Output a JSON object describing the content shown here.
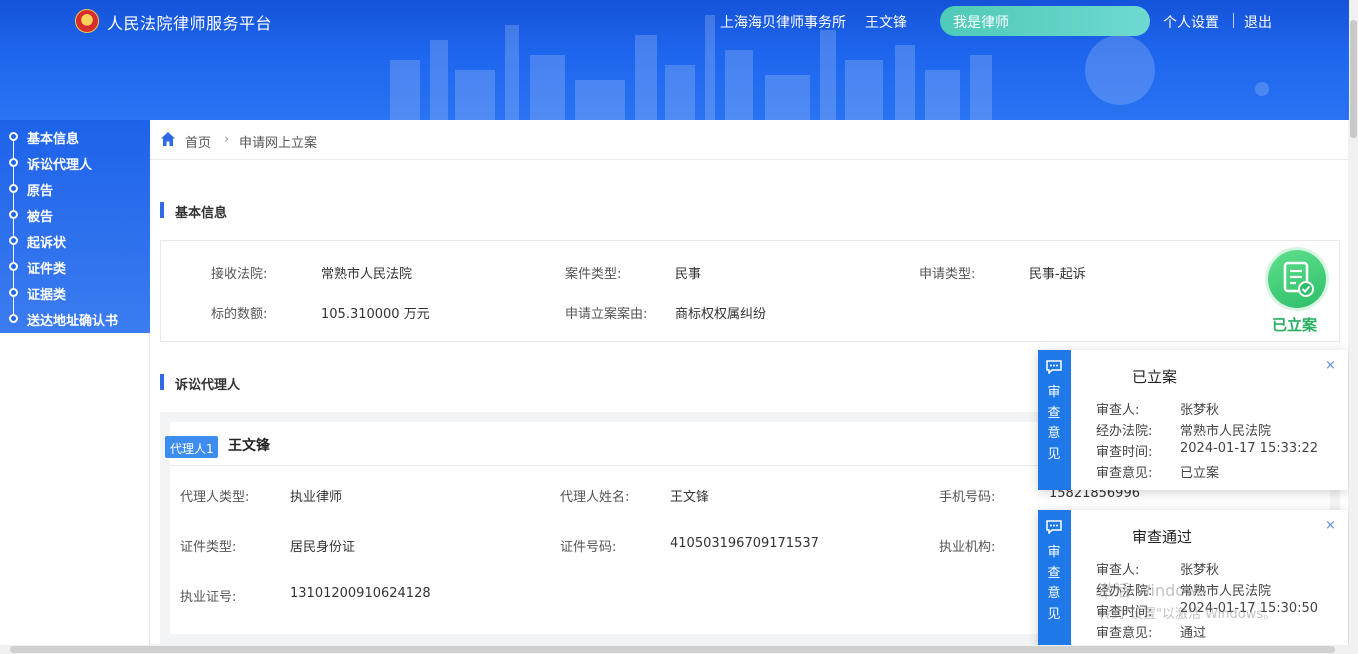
{
  "header": {
    "app_title": "人民法院律师服务平台",
    "firm": "上海海贝律师事务所",
    "user": "王文锋",
    "role": "我是律师",
    "settings": "个人设置",
    "logout": "退出",
    "accent": "#1e66ee"
  },
  "sidebar": {
    "items": [
      {
        "label": "基本信息"
      },
      {
        "label": "诉讼代理人"
      },
      {
        "label": "原告"
      },
      {
        "label": "被告"
      },
      {
        "label": "起诉状"
      },
      {
        "label": "证件类"
      },
      {
        "label": "证据类"
      },
      {
        "label": "送达地址确认书"
      }
    ]
  },
  "breadcrumb": {
    "home": "首页",
    "current": "申请网上立案"
  },
  "basic": {
    "title": "基本信息",
    "court_label": "接收法院:",
    "court_value": "常熟市人民法院",
    "case_type_label": "案件类型:",
    "case_type_value": "民事",
    "apply_type_label": "申请类型:",
    "apply_type_value": "民事-起诉",
    "amount_label": "标的数额:",
    "amount_value": "105.310000 万元",
    "cause_label": "申请立案案由:",
    "cause_value": "商标权权属纠纷",
    "status_stamp": "已立案",
    "status_color": "#27ae60"
  },
  "agents": {
    "title": "诉讼代理人",
    "tag": "代理人1",
    "name": "王文锋",
    "type_label": "代理人类型:",
    "type_value": "执业律师",
    "name_label": "代理人姓名:",
    "name_value": "王文锋",
    "phone_label": "手机号码:",
    "phone_value": "15821856996",
    "id_type_label": "证件类型:",
    "id_type_value": "居民身份证",
    "id_no_label": "证件号码:",
    "id_no_value": "410503196709171537",
    "org_label": "执业机构:",
    "license_label": "执业证号:",
    "license_value": "13101200910624128"
  },
  "reviews": [
    {
      "side_text": "审查意见",
      "title": "已立案",
      "close": "×",
      "reviewer_label": "审查人:",
      "reviewer": "张梦秋",
      "court_label": "经办法院:",
      "court": "常熟市人民法院",
      "time_label": "审查时间:",
      "time": "2024-01-17 15:33:22",
      "opinion_label": "审查意见:",
      "opinion": "已立案"
    },
    {
      "side_text": "审查意见",
      "title": "审查通过",
      "close": "×",
      "reviewer_label": "审查人:",
      "reviewer": "张梦秋",
      "court_label": "经办法院:",
      "court": "常熟市人民法院",
      "time_label": "审查时间:",
      "time": "2024-01-17 15:30:50",
      "opinion_label": "审查意见:",
      "opinion": "通过"
    }
  ],
  "watermark": {
    "line1": "激活 Windows",
    "line2": "转到\"设置\"以激活 Windows。"
  }
}
